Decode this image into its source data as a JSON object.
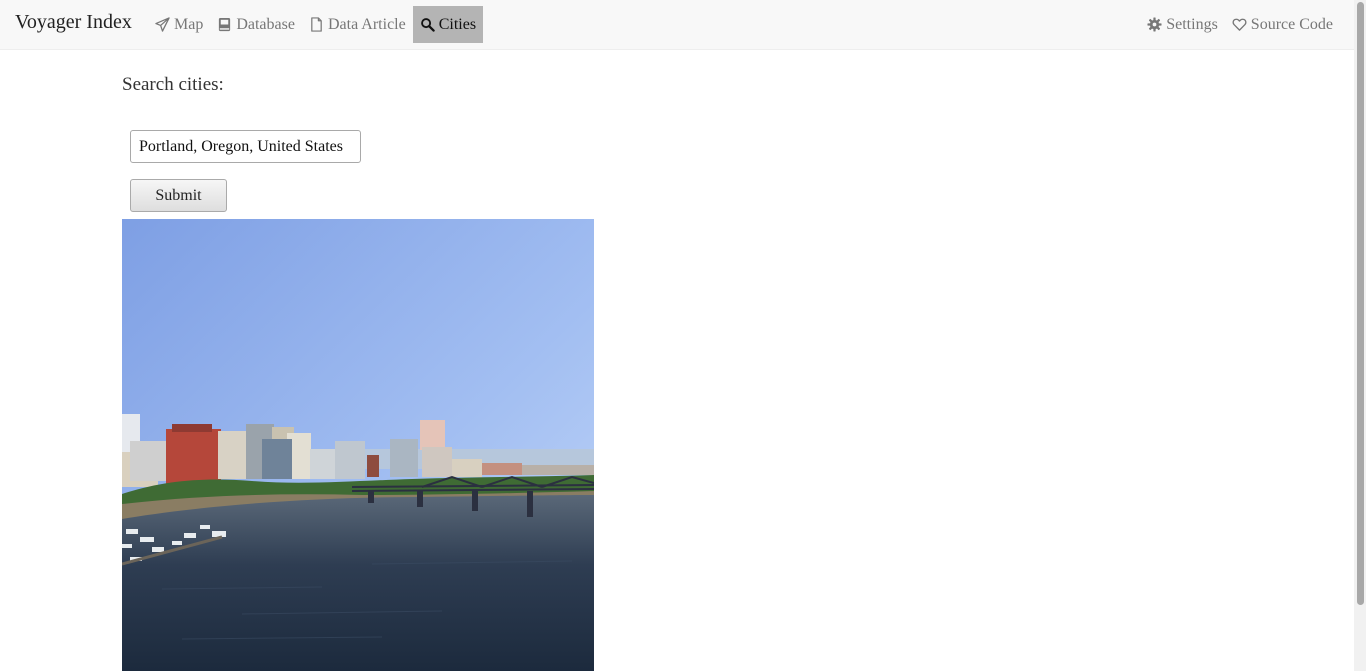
{
  "app": {
    "brand": "Voyager Index"
  },
  "nav": {
    "left": [
      {
        "label": "Map",
        "icon": "paper-plane-icon"
      },
      {
        "label": "Database",
        "icon": "book-icon"
      },
      {
        "label": "Data Article",
        "icon": "file-icon"
      },
      {
        "label": "Cities",
        "icon": "search-icon",
        "active": true
      }
    ],
    "right": [
      {
        "label": "Settings",
        "icon": "gear-icon"
      },
      {
        "label": "Source Code",
        "icon": "heart-icon"
      }
    ]
  },
  "search": {
    "label": "Search cities:",
    "value": "Portland, Oregon, United States",
    "submit_label": "Submit"
  },
  "photo": {
    "subject": "Portland skyline and Willamette River"
  },
  "colors": {
    "navbar_bg": "#f8f8f8",
    "active_tab_bg": "#b4b4b4",
    "nav_text": "#777777"
  }
}
